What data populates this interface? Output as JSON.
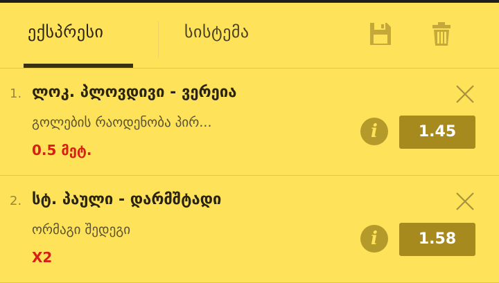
{
  "tabs": {
    "express_label": "ექსპრესი",
    "system_label": "სისტემა"
  },
  "toolbar": {
    "save_icon": "save-icon",
    "delete_icon": "trash-icon"
  },
  "bets": [
    {
      "index": "1.",
      "match": "ლოკ. პლოვდივი - ვერეია",
      "market": "გოლების რაოდენობა პირ...",
      "pick": "0.5 მეტ.",
      "odds": "1.45"
    },
    {
      "index": "2.",
      "match": "სტ. პაული - დარმშტადი",
      "market": "ორმაგი შედეგი",
      "pick": "X2",
      "odds": "1.58"
    }
  ],
  "colors": {
    "background": "#fde25a",
    "odds_button": "#a68a1e",
    "pick_text": "#d81f14",
    "info_icon": "#b49a2a"
  }
}
